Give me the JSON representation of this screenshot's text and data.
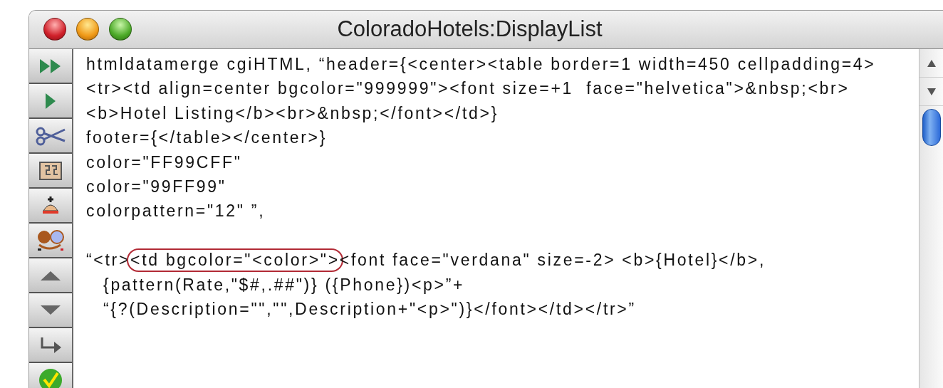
{
  "window": {
    "title": "ColoradoHotels:DisplayList"
  },
  "code_blocks": [
    {
      "lines": [
        {
          "text": "htmldatamerge cgiHTML, “header={<center><table border=1 width=450 cellpadding=4>",
          "indented": false
        },
        {
          "text": "<tr><td align=center bgcolor=\"999999\"><font size=+1  face=\"helvetica\">&nbsp;<br>",
          "indented": false
        },
        {
          "text": "<b>Hotel Listing</b><br>&nbsp;</font></td>}",
          "indented": false
        },
        {
          "text": "footer={</table></center>}",
          "indented": false
        },
        {
          "text": "color=\"FF99CFF\"",
          "indented": false
        },
        {
          "text": "color=\"99FF99\"",
          "indented": false
        },
        {
          "text": "colorpattern=\"12\" ”,",
          "indented": false
        }
      ]
    },
    {
      "lines": [
        {
          "segments": [
            {
              "text": "“<tr>",
              "circled": false
            },
            {
              "text": "<td bgcolor=\"<color>\">",
              "circled": true
            },
            {
              "text": "<font face=\"verdana\" size=-2> <b>{Hotel}</b>,",
              "circled": false
            }
          ],
          "indented": false
        },
        {
          "text": "{pattern(Rate,\"$#,.##\")} ({Phone})<p>”+",
          "indented": true
        },
        {
          "text": "“{?(Description=\"\",\"\",Description+\"<p>\")}</font></td></tr>”",
          "indented": true
        }
      ]
    }
  ]
}
